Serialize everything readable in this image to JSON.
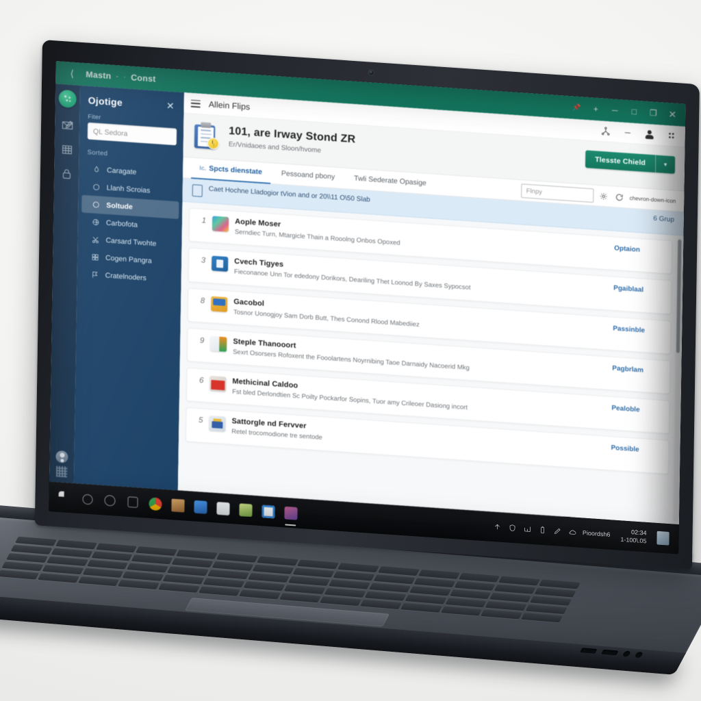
{
  "window": {
    "titlebar": {
      "back_icon": "back-arrow-icon",
      "breadcrumb_root": "Mastn",
      "breadcrumb_sep": "-",
      "breadcrumb_leaf": "Const",
      "pin_icon": "pin-icon",
      "new_label": "+",
      "minimize_label": "─",
      "maximize_label": "□",
      "restore_label": "❐",
      "close_label": "✕"
    },
    "rail": {
      "logo_icon": "app-logo-icon",
      "items": [
        {
          "icon": "mail-edit-icon"
        },
        {
          "icon": "grid-table-icon"
        },
        {
          "icon": "lock-icon"
        }
      ],
      "avatar_icon": "user-avatar-icon",
      "qr_icon": "qr-code-icon"
    },
    "sidebar": {
      "title": "Ojotige",
      "close_label": "✕",
      "field_label": "Fiter",
      "search_value": "QL Sedora",
      "group_label": "Sorted",
      "items": [
        {
          "label": "Caragate",
          "icon": "drop-icon",
          "active": false
        },
        {
          "label": "Llanh Scroias",
          "icon": "circle-icon",
          "active": false
        },
        {
          "label": "Soltude",
          "icon": "swirl-icon",
          "active": true
        },
        {
          "label": "Carbofota",
          "icon": "spiral-icon",
          "active": false
        },
        {
          "label": "Carsard Twohte",
          "icon": "scissors-icon",
          "active": false
        },
        {
          "label": "Cogen Pangra",
          "icon": "blocks-icon",
          "active": false
        },
        {
          "label": "Cratelnoders",
          "icon": "flag-icon",
          "active": false
        }
      ]
    },
    "content": {
      "hamburger_icon": "hamburger-menu-icon",
      "topbar_title": "Allein Flips",
      "top_icons": [
        {
          "icon": "share-tree-icon"
        },
        {
          "icon": "minimize-dash-icon"
        },
        {
          "icon": "person-icon"
        },
        {
          "icon": "apps-grid-icon"
        }
      ],
      "header": {
        "doc_icon": "clipboard-clock-icon",
        "title": "101, are Irway Stond ZR",
        "subtitle": "Er/Vnidaoes and Sloon/hvome",
        "primary_button": "Tlesste Chield",
        "split_caret": "▾"
      },
      "tabs": [
        {
          "prefix": "Ic.",
          "label": "Spcts dienstate",
          "active": true
        },
        {
          "prefix": "",
          "label": "Pessoand pbony",
          "active": false
        },
        {
          "prefix": "",
          "label": "Twli Sederate Opasige",
          "active": false
        }
      ],
      "tools": {
        "search_placeholder": "Flnpy",
        "settings_icon": "gear-icon",
        "refresh_icon": "refresh-icon",
        "caret_icon": "chevron-down-icon"
      },
      "banner": {
        "icon": "document-outline-icon",
        "text": "Caet Hochne Lladogior tVion and or 20\\\\11 O\\50 Slab",
        "count": "6 Grup"
      },
      "list": [
        {
          "num": "1",
          "icon": "photo-app-icon",
          "icon_style": "ic-a",
          "title": "Aople Moser",
          "desc": "Serndiec Turn, Mtargicle Thain a Rooolng Onbos Opoxed",
          "status": "Optaion"
        },
        {
          "num": "3",
          "icon": "presentation-app-icon",
          "icon_style": "ic-b",
          "title": "Cvech Tigyes",
          "desc": "Fieconanoe Unn Tor ededony Dorikors, Deariling Thet Loonod By Saxes Sypocsot",
          "status": "Pgaiblaal"
        },
        {
          "num": "8",
          "icon": "folder-app-icon",
          "icon_style": "ic-c",
          "title": "Gacobol",
          "desc": "Tosnor Uonogjoy Sam Dorb Butt, Thes Conond Rlood Mabediiez",
          "status": "Passinble"
        },
        {
          "num": "9",
          "icon": "spray-app-icon",
          "icon_style": "ic-d",
          "title": "Steple Thanooort",
          "desc": "Sexrt Osorsers Rofoxent the Fooolartens Noyrnibing Taoe Darnaidy Nacoerid Mkg",
          "status": "Pagbrlam"
        },
        {
          "num": "6",
          "icon": "package-app-icon",
          "icon_style": "ic-e",
          "title": "Methicinal Caldoo",
          "desc": "Fst bled Derlondtien Sc Poilty Pockarfor Sopins, Tuor amy Crileoer Dasiong incort",
          "status": "Pealoble"
        },
        {
          "num": "5",
          "icon": "settings-app-icon",
          "icon_style": "ic-f",
          "title": "Sattorgle nd Fervver",
          "desc": "Retel trocomodione tre sentode",
          "status": "Possible"
        }
      ]
    }
  },
  "taskbar": {
    "apps": [
      {
        "name": "start-button",
        "color": "#ffffff",
        "running": false
      },
      {
        "name": "search-icon",
        "color": "#6d737a",
        "running": false
      },
      {
        "name": "task-view-icon",
        "color": "#7a8088",
        "running": false
      },
      {
        "name": "widgets-icon",
        "color": "#6f757c",
        "running": false
      },
      {
        "name": "chrome-icon",
        "color": "#e8a33d",
        "running": false
      },
      {
        "name": "store-icon",
        "color": "#c98a4f",
        "running": false
      },
      {
        "name": "mail-icon",
        "color": "#3d7fd0",
        "running": false
      },
      {
        "name": "camera-icon",
        "color": "#e6e9ec",
        "running": false
      },
      {
        "name": "photos-icon",
        "color": "#93c45b",
        "running": false
      },
      {
        "name": "explorer-icon",
        "color": "#2e86d8",
        "running": false
      },
      {
        "name": "app-window-icon",
        "color": "#b8547f",
        "running": true
      }
    ],
    "tray": [
      {
        "icon": "show-hidden-icons-chevron"
      },
      {
        "icon": "antivirus-shield-icon"
      },
      {
        "icon": "network-icon"
      },
      {
        "icon": "battery-icon"
      },
      {
        "icon": "pen-icon"
      },
      {
        "icon": "onedrive-icon"
      }
    ],
    "tray_label": "Pioordsh6",
    "clock_time": "02:34",
    "clock_date": "1-100\\.05",
    "note_icon": "notification-note-icon"
  }
}
